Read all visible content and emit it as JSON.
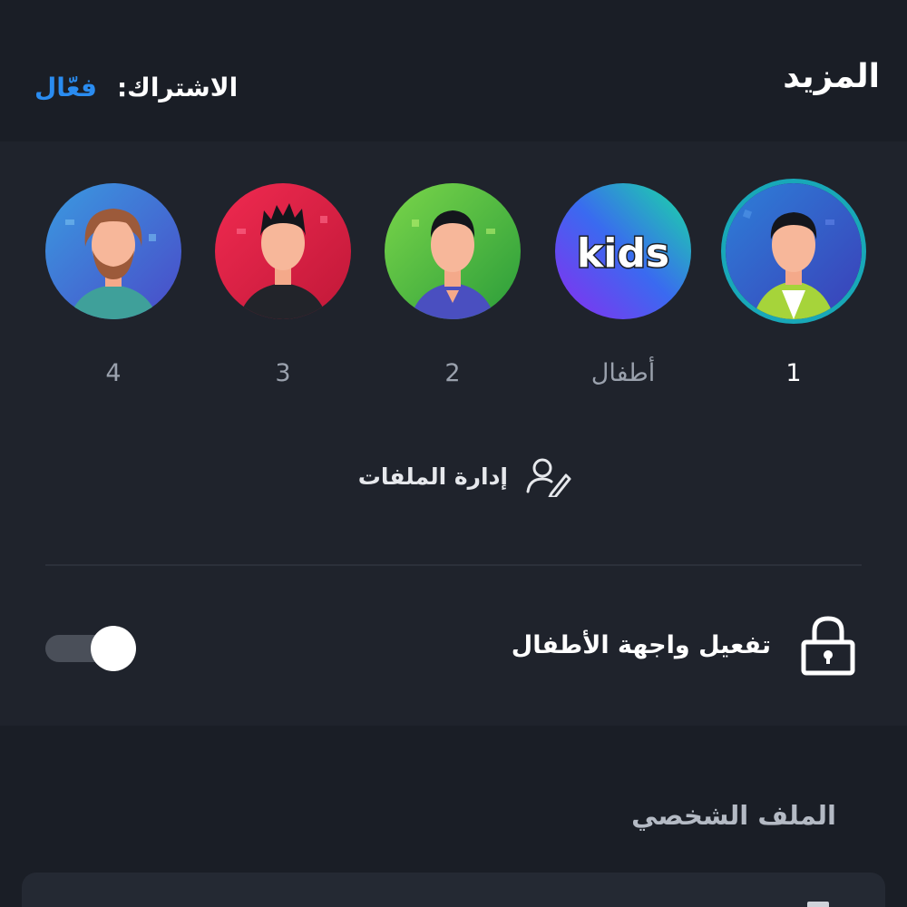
{
  "header": {
    "title": "المزيد",
    "subscription_label": "الاشتراك:",
    "subscription_status": "فعّال"
  },
  "profiles": [
    {
      "name": "1",
      "avatar": "man-green-jacket-avatar",
      "selected": true
    },
    {
      "name": "أطفال",
      "avatar": "kids-avatar",
      "badge": "kids",
      "selected": false
    },
    {
      "name": "2",
      "avatar": "man-green-bg-avatar",
      "selected": false
    },
    {
      "name": "3",
      "avatar": "man-red-bg-avatar",
      "selected": false
    },
    {
      "name": "4",
      "avatar": "bearded-man-avatar",
      "selected": false
    }
  ],
  "manage_profiles": {
    "label": "إدارة الملفات",
    "icon": "user-edit-icon"
  },
  "kids_mode": {
    "label": "تفعيل واجهة الأطفال",
    "icon": "lock-icon",
    "enabled": true
  },
  "profile_section": {
    "title": "الملف الشخصي"
  },
  "colors": {
    "accent": "#2a8cf0",
    "selected_ring": "#18a8b8",
    "background": "#1a1e26",
    "panel": "#1f232c"
  }
}
